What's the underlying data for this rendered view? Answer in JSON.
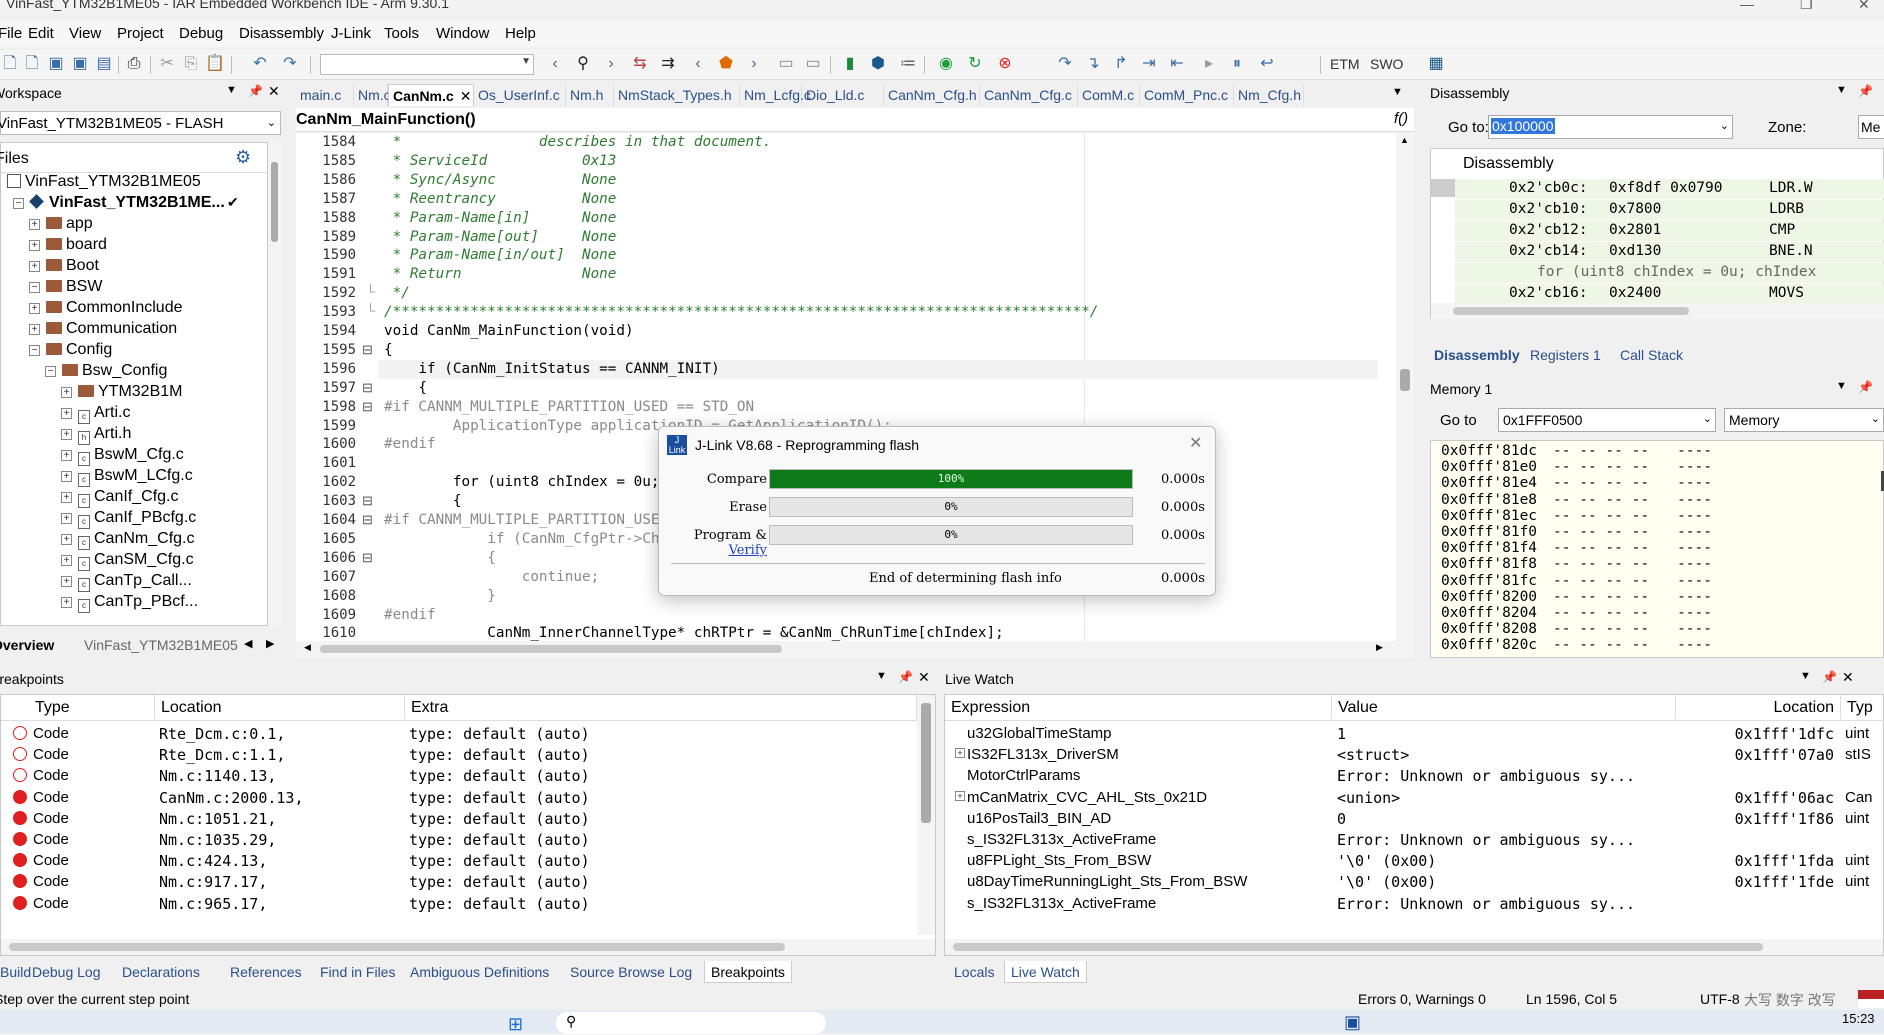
{
  "window": {
    "title": "VinFast_YTM32B1ME05 - IAR Embedded Workbench IDE - Arm 9.30.1"
  },
  "menu": [
    "File",
    "Edit",
    "View",
    "Project",
    "Debug",
    "Disassembly",
    "J-Link",
    "Tools",
    "Window",
    "Help"
  ],
  "toolbar": {
    "etm": "ETM",
    "swo": "SWO"
  },
  "workspace": {
    "title": "Workspace",
    "config": "VinFast_YTM32B1ME05 - FLASH",
    "files_label": "Files",
    "tree": [
      {
        "label": "VinFast_YTM32B1ME05",
        "level": 0,
        "kind": "ws"
      },
      {
        "label": "VinFast_YTM32B1ME...",
        "level": 1,
        "kind": "proj",
        "check": "✔"
      },
      {
        "label": "app",
        "level": 2,
        "kind": "folder"
      },
      {
        "label": "board",
        "level": 2,
        "kind": "folder"
      },
      {
        "label": "Boot",
        "level": 2,
        "kind": "folder"
      },
      {
        "label": "BSW",
        "level": 2,
        "kind": "folder"
      },
      {
        "label": "CommonInclude",
        "level": 3,
        "kind": "folder"
      },
      {
        "label": "Communication",
        "level": 3,
        "kind": "folder"
      },
      {
        "label": "Config",
        "level": 3,
        "kind": "folder"
      },
      {
        "label": "Bsw_Config",
        "level": 4,
        "kind": "folder"
      },
      {
        "label": "YTM32B1M",
        "level": 5,
        "kind": "folder"
      },
      {
        "label": "Arti.c",
        "level": 5,
        "kind": "file"
      },
      {
        "label": "Arti.h",
        "level": 5,
        "kind": "hfile"
      },
      {
        "label": "BswM_Cfg.c",
        "level": 5,
        "kind": "file"
      },
      {
        "label": "BswM_LCfg.c",
        "level": 5,
        "kind": "file"
      },
      {
        "label": "CanIf_Cfg.c",
        "level": 5,
        "kind": "file"
      },
      {
        "label": "CanIf_PBcfg.c",
        "level": 5,
        "kind": "file"
      },
      {
        "label": "CanNm_Cfg.c",
        "level": 5,
        "kind": "file"
      },
      {
        "label": "CanSM_Cfg.c",
        "level": 5,
        "kind": "file"
      },
      {
        "label": "CanTp_Call...",
        "level": 5,
        "kind": "file"
      },
      {
        "label": "CanTp_PBcf...",
        "level": 5,
        "kind": "file"
      }
    ],
    "bottom_tabs": [
      "Overview",
      "VinFast_YTM32B1ME05"
    ]
  },
  "editor": {
    "tabs": [
      "main.c",
      "Nm.c",
      "CanNm.c",
      "Os_UserInf.c",
      "Nm.h",
      "NmStack_Types.h",
      "Nm_Lcfg.c",
      "Dio_Lld.c",
      "CanNm_Cfg.h",
      "CanNm_Cfg.c",
      "ComM.c",
      "ComM_Pnc.c",
      "Nm_Cfg.h"
    ],
    "active_tab": "CanNm.c",
    "function_label": "CanNm_MainFunction()",
    "lines": [
      {
        "n": "1584",
        "t": " *                describes in that document.",
        "c": "cm"
      },
      {
        "n": "1585",
        "t": " * ServiceId           0x13",
        "c": "cm"
      },
      {
        "n": "1586",
        "t": " * Sync/Async          None",
        "c": "cm"
      },
      {
        "n": "1587",
        "t": " * Reentrancy          None",
        "c": "cm"
      },
      {
        "n": "1588",
        "t": " * Param-Name[in]      None",
        "c": "cm"
      },
      {
        "n": "1589",
        "t": " * Param-Name[out]     None",
        "c": "cm"
      },
      {
        "n": "1590",
        "t": " * Param-Name[in/out]  None",
        "c": "cm"
      },
      {
        "n": "1591",
        "t": " * Return              None",
        "c": "cm"
      },
      {
        "n": "1592",
        "t": " */",
        "c": "cm"
      },
      {
        "n": "1593",
        "t": "/*********************************************************************************/",
        "c": "cm"
      },
      {
        "n": "1594",
        "t": "void CanNm_MainFunction(void)",
        "c": ""
      },
      {
        "n": "1595",
        "t": "{",
        "c": ""
      },
      {
        "n": "1596",
        "t": "    if (CanNm_InitStatus == CANNM_INIT)",
        "c": ""
      },
      {
        "n": "1597",
        "t": "    {",
        "c": ""
      },
      {
        "n": "1598",
        "t": "#if CANNM_MULTIPLE_PARTITION_USED == STD_ON",
        "c": "pp"
      },
      {
        "n": "1599",
        "t": "        ApplicationType applicationID = GetApplicationID();",
        "c": "pp"
      },
      {
        "n": "1600",
        "t": "#endif",
        "c": "pp"
      },
      {
        "n": "1601",
        "t": "",
        "c": ""
      },
      {
        "n": "1602",
        "t": "        for (uint8 chIndex = 0u; chIndex",
        "c": ""
      },
      {
        "n": "1603",
        "t": "        {",
        "c": ""
      },
      {
        "n": "1604",
        "t": "#if CANNM_MULTIPLE_PARTITION_USED == STD_ON",
        "c": "pp"
      },
      {
        "n": "1605",
        "t": "            if (CanNm_CfgPtr->ChannelConfig[chIndex]",
        "c": "pp"
      },
      {
        "n": "1606",
        "t": "            {",
        "c": "pp"
      },
      {
        "n": "1607",
        "t": "                continue;",
        "c": "pp"
      },
      {
        "n": "1608",
        "t": "            }",
        "c": "pp"
      },
      {
        "n": "1609",
        "t": "#endif",
        "c": "pp"
      },
      {
        "n": "1610",
        "t": "            CanNm_InnerChannelType* chRTPtr = &CanNm_ChRunTime[chIndex];",
        "c": ""
      }
    ]
  },
  "dialog": {
    "title": "J-Link V8.68 - Reprogramming flash",
    "rows": [
      {
        "label": "Compare",
        "pct_text": "100%",
        "fill": 1.0,
        "time": "0.000s"
      },
      {
        "label": "Erase",
        "pct_text": "0%",
        "fill": 0.0,
        "time": "0.000s"
      },
      {
        "label": "Program & ",
        "pct_text": "0%",
        "fill": 0.0,
        "time": "0.000s",
        "link": "Verify"
      }
    ],
    "status": "End of determining flash info",
    "status_time": "0.000s"
  },
  "disassembly": {
    "title": "Disassembly",
    "goto_label": "Go to:",
    "goto_value": "0x100000",
    "zone_label": "Zone:",
    "zone_value": "Me",
    "header": "Disassembly",
    "lines": [
      {
        "addr": "0x2'cb0c:",
        "code": "0xf8df 0x0790",
        "op": "LDR.W",
        "src": false
      },
      {
        "addr": "0x2'cb10:",
        "code": "0x7800",
        "op": "LDRB",
        "src": false
      },
      {
        "addr": "0x2'cb12:",
        "code": "0x2801",
        "op": "CMP",
        "src": false
      },
      {
        "addr": "0x2'cb14:",
        "code": "0xd130",
        "op": "BNE.N",
        "src": false
      },
      {
        "addr": "",
        "code": "for (uint8 chIndex = 0u; chIndex",
        "op": "",
        "src": true
      },
      {
        "addr": "0x2'cb16:",
        "code": "0x2400",
        "op": "MOVS",
        "src": false
      }
    ],
    "tabs": [
      "Disassembly",
      "Registers 1",
      "Call Stack"
    ]
  },
  "memory": {
    "title": "Memory 1",
    "goto_label": "Go to",
    "goto_value": "0x1FFF0500",
    "type": "Memory",
    "rows": [
      {
        "addr": "0x0fff'81dc",
        "bytes": "-- -- -- --",
        "ascii": "----"
      },
      {
        "addr": "0x0fff'81e0",
        "bytes": "-- -- -- --",
        "ascii": "----"
      },
      {
        "addr": "0x0fff'81e4",
        "bytes": "-- -- -- --",
        "ascii": "----"
      },
      {
        "addr": "0x0fff'81e8",
        "bytes": "-- -- -- --",
        "ascii": "----"
      },
      {
        "addr": "0x0fff'81ec",
        "bytes": "-- -- -- --",
        "ascii": "----"
      },
      {
        "addr": "0x0fff'81f0",
        "bytes": "-- -- -- --",
        "ascii": "----"
      },
      {
        "addr": "0x0fff'81f4",
        "bytes": "-- -- -- --",
        "ascii": "----"
      },
      {
        "addr": "0x0fff'81f8",
        "bytes": "-- -- -- --",
        "ascii": "----"
      },
      {
        "addr": "0x0fff'81fc",
        "bytes": "-- -- -- --",
        "ascii": "----"
      },
      {
        "addr": "0x0fff'8200",
        "bytes": "-- -- -- --",
        "ascii": "----"
      },
      {
        "addr": "0x0fff'8204",
        "bytes": "-- -- -- --",
        "ascii": "----"
      },
      {
        "addr": "0x0fff'8208",
        "bytes": "-- -- -- --",
        "ascii": "----"
      },
      {
        "addr": "0x0fff'820c",
        "bytes": "-- -- -- --",
        "ascii": "----"
      }
    ]
  },
  "breakpoints": {
    "title": "Breakpoints",
    "columns": [
      "Type",
      "Location",
      "Extra"
    ],
    "rows": [
      {
        "enabled": false,
        "type": "Code",
        "location": "Rte_Dcm.c:0.1,",
        "extra": "type: default (auto)"
      },
      {
        "enabled": false,
        "type": "Code",
        "location": "Rte_Dcm.c:1.1,",
        "extra": "type: default (auto)"
      },
      {
        "enabled": false,
        "type": "Code",
        "location": "Nm.c:1140.13,",
        "extra": "type: default (auto)"
      },
      {
        "enabled": true,
        "type": "Code",
        "location": "CanNm.c:2000.13,",
        "extra": "type: default (auto)"
      },
      {
        "enabled": true,
        "type": "Code",
        "location": "Nm.c:1051.21,",
        "extra": "type: default (auto)"
      },
      {
        "enabled": true,
        "type": "Code",
        "location": "Nm.c:1035.29,",
        "extra": "type: default (auto)"
      },
      {
        "enabled": true,
        "type": "Code",
        "location": "Nm.c:424.13,",
        "extra": "type: default (auto)"
      },
      {
        "enabled": true,
        "type": "Code",
        "location": "Nm.c:917.17,",
        "extra": "type: default (auto)"
      },
      {
        "enabled": true,
        "type": "Code",
        "location": "Nm.c:965.17,",
        "extra": "type: default (auto)"
      }
    ],
    "bottom_tabs": [
      "Build",
      "Debug Log",
      "Declarations",
      "References",
      "Find in Files",
      "Ambiguous Definitions",
      "Source Browse Log",
      "Breakpoints"
    ]
  },
  "livewatch": {
    "title": "Live Watch",
    "columns": [
      "Expression",
      "Value",
      "Location",
      "Typ"
    ],
    "rows": [
      {
        "expand": false,
        "expr": "u32GlobalTimeStamp",
        "value": "1",
        "loc": "0x1fff'1dfc",
        "type": "uint"
      },
      {
        "expand": true,
        "expr": "IS32FL313x_DriverSM",
        "value": "<struct>",
        "loc": "0x1fff'07a0",
        "type": "stIS"
      },
      {
        "expand": false,
        "expr": "MotorCtrlParams",
        "value": "Error: Unknown or ambiguous sy...",
        "loc": "",
        "type": ""
      },
      {
        "expand": true,
        "expr": "mCanMatrix_CVC_AHL_Sts_0x21D",
        "value": "<union>",
        "loc": "0x1fff'06ac",
        "type": "Can"
      },
      {
        "expand": false,
        "expr": "u16PosTail3_BIN_AD",
        "value": "0",
        "loc": "0x1fff'1f86",
        "type": "uint"
      },
      {
        "expand": false,
        "expr": "s_IS32FL313x_ActiveFrame",
        "value": "Error: Unknown or ambiguous sy...",
        "loc": "",
        "type": ""
      },
      {
        "expand": false,
        "expr": "u8FPLight_Sts_From_BSW",
        "value": "'\\0' (0x00)",
        "loc": "0x1fff'1fda",
        "type": "uint"
      },
      {
        "expand": false,
        "expr": "u8DayTimeRunningLight_Sts_From_BSW",
        "value": "'\\0' (0x00)",
        "loc": "0x1fff'1fde",
        "type": "uint"
      },
      {
        "expand": false,
        "expr": "s_IS32FL313x_ActiveFrame",
        "value": "Error: Unknown or ambiguous sy...",
        "loc": "",
        "type": ""
      }
    ],
    "bottom_tabs": [
      "Locals",
      "Live Watch"
    ]
  },
  "status": {
    "left": "Step over the current step point",
    "errors": "Errors 0, Warnings 0",
    "position": "Ln 1596, Col 5",
    "encoding": "UTF-8",
    "ime": "大写 数字 改写"
  },
  "taskbar": {
    "clock": "15:23"
  },
  "colors": {
    "accent": "#2a4f8a",
    "progress": "#0f7a1a",
    "bp_enabled": "#e02020",
    "comment": "#2e7d32",
    "keyword": "#0000cd"
  }
}
